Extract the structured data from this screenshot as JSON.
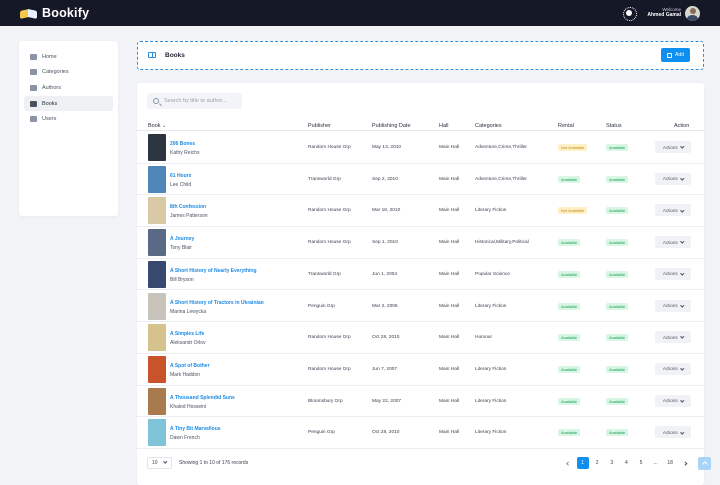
{
  "app": {
    "name": "Bookify"
  },
  "user": {
    "welcome": "Welcome",
    "name": "Ahmed Gamal"
  },
  "sidebar": {
    "items": [
      {
        "label": "Home",
        "icon": "home-icon",
        "active": false
      },
      {
        "label": "Categories",
        "icon": "categories-icon",
        "active": false
      },
      {
        "label": "Authors",
        "icon": "authors-icon",
        "active": false
      },
      {
        "label": "Books",
        "icon": "book-icon",
        "active": true
      },
      {
        "label": "Users",
        "icon": "users-icon",
        "active": false
      }
    ]
  },
  "header": {
    "title": "Books",
    "add_label": "Add"
  },
  "search": {
    "placeholder": "Search by title or author..."
  },
  "table": {
    "columns": [
      "Book",
      "Publisher",
      "Publishing Date",
      "Hall",
      "Categories",
      "Rental",
      "Status",
      "Action"
    ],
    "action_label": "Actions",
    "rows": [
      {
        "title": "206 Bones",
        "author": "Kathy Reichs",
        "publisher": "Random House Grp",
        "date": "May 13, 2010",
        "hall": "Main Hall",
        "categories": "Adventure,Crime,Thriller",
        "rental": "Not Available",
        "status": "Available",
        "cover": "#2c3440"
      },
      {
        "title": "61 Hours",
        "author": "Lee Child",
        "publisher": "Transworld Grp",
        "date": "Sep 2, 2010",
        "hall": "Main Hall",
        "categories": "Adventure,Crime,Thriller",
        "rental": "Available",
        "status": "Available",
        "cover": "#4f86b8"
      },
      {
        "title": "8th Confession",
        "author": "James Patterson",
        "publisher": "Random House Grp",
        "date": "Mar 18, 2010",
        "hall": "Main Hall",
        "categories": "Literary Fiction",
        "rental": "Not Available",
        "status": "Available",
        "cover": "#d8c9a4"
      },
      {
        "title": "A Journey",
        "author": "Tony Blair",
        "publisher": "Random House Grp",
        "date": "Sep 1, 2010",
        "hall": "Main Hall",
        "categories": "Historical,Military,Political",
        "rental": "Available",
        "status": "Available",
        "cover": "#5a6a86"
      },
      {
        "title": "A Short History of Nearly Everything",
        "author": "Bill Bryson",
        "publisher": "Transworld Grp",
        "date": "Jun 1, 2004",
        "hall": "Main Hall",
        "categories": "Popular Science",
        "rental": "Available",
        "status": "Available",
        "cover": "#37496e"
      },
      {
        "title": "A Short History of Tractors in Ukrainian",
        "author": "Marina Lewycka",
        "publisher": "Penguin Grp",
        "date": "Mar 2, 2006",
        "hall": "Main Hall",
        "categories": "Literary Fiction",
        "rental": "Available",
        "status": "Available",
        "cover": "#c8c4bc"
      },
      {
        "title": "A Simples Life",
        "author": "Aleksandr Orlov",
        "publisher": "Random House Grp",
        "date": "Oct 28, 2010",
        "hall": "Main Hall",
        "categories": "Humour",
        "rental": "Available",
        "status": "Available",
        "cover": "#d6c28c"
      },
      {
        "title": "A Spot of Bother",
        "author": "Mark Haddon",
        "publisher": "Random House Grp",
        "date": "Jun 7, 2007",
        "hall": "Main Hall",
        "categories": "Literary Fiction",
        "rental": "Available",
        "status": "Available",
        "cover": "#c9542c"
      },
      {
        "title": "A Thousand Splendid Suns",
        "author": "Khaled Hosseini",
        "publisher": "Bloomsbury Grp",
        "date": "May 22, 2007",
        "hall": "Main Hall",
        "categories": "Literary Fiction",
        "rental": "Available",
        "status": "Available",
        "cover": "#a87a4c"
      },
      {
        "title": "A Tiny Bit Marvellous",
        "author": "Dawn French",
        "publisher": "Penguin Grp",
        "date": "Oct 28, 2010",
        "hall": "Main Hall",
        "categories": "Literary Fiction",
        "rental": "Available",
        "status": "Available",
        "cover": "#7fc3d8"
      }
    ]
  },
  "footer": {
    "per_page": "10",
    "showing": "Showing 1 to 10 of 176 records",
    "pages": [
      "1",
      "2",
      "3",
      "4",
      "5",
      "...",
      "18"
    ],
    "current_page": "1"
  },
  "colors": {
    "accent": "#0f8fef",
    "topbar": "#141827",
    "available": "#1a9b52",
    "not_available": "#c58a10"
  }
}
